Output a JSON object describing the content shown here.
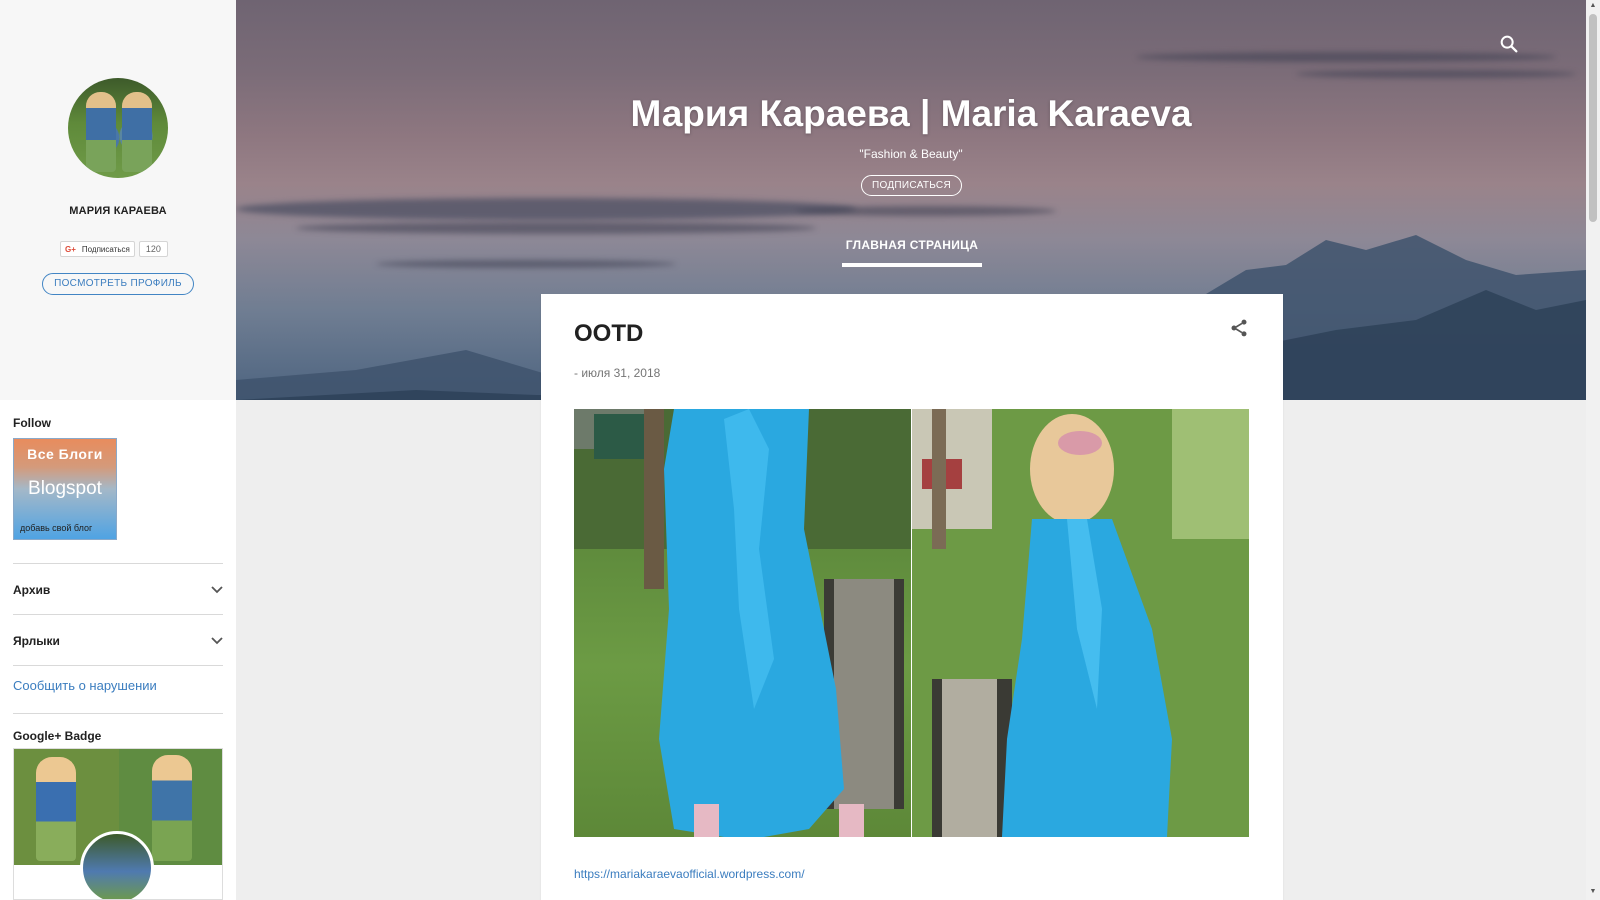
{
  "header": {
    "blog_title": "Мария Караева | Maria Karaeva",
    "description": "\"Fashion & Beauty\"",
    "subscribe_label": "ПОДПИСАТЬСЯ",
    "nav_home": "ГЛАВНАЯ СТРАНИЦА",
    "search_icon": "search-icon"
  },
  "sidebar": {
    "profile_name": "МАРИЯ КАРАЕВА",
    "gplus_follow_label": "Подписаться",
    "gplus_count": "120",
    "view_profile_label": "ПОСМОТРЕТЬ ПРОФИЛЬ",
    "follow_title": "Follow",
    "badge": {
      "line1": "Все Блоги",
      "line2": "Blogspot",
      "line3": "добавь свой блог"
    },
    "archive_label": "Архив",
    "labels_label": "Ярлыки",
    "report_link": "Сообщить о нарушении",
    "google_badge_title": "Google+ Badge"
  },
  "post": {
    "title": "OOTD",
    "date": "- июля 31, 2018",
    "link": "https://mariakaraevaofficial.wordpress.com/"
  },
  "colors": {
    "accent": "#3b7dbf",
    "dress_blue": "#2aa8e0",
    "page_bg": "#eeeeee"
  }
}
